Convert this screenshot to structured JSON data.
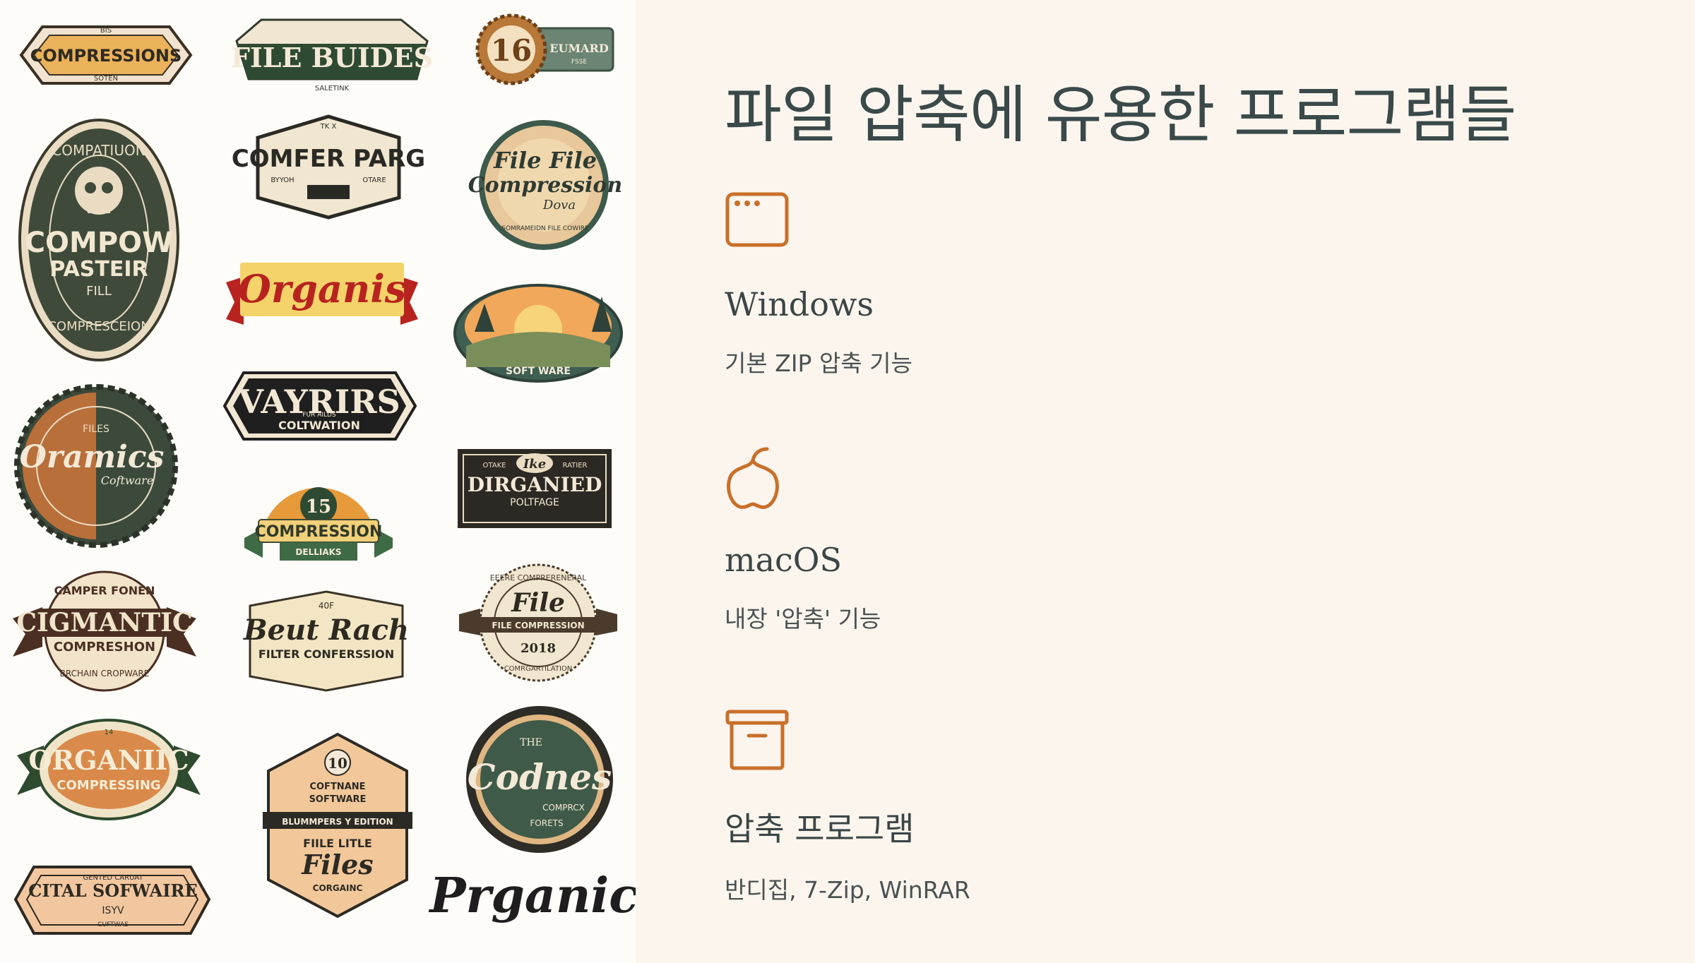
{
  "title": "파일 압축에 유용한 프로그램들",
  "accent_color": "#c8702a",
  "features": [
    {
      "icon": "window-icon",
      "heading": "Windows",
      "description": "기본 ZIP 압축 기능"
    },
    {
      "icon": "apple-icon",
      "heading": "macOS",
      "description": "내장 '압축' 기능"
    },
    {
      "icon": "archive-box-icon",
      "heading": "압축 프로그램",
      "description": "반디집, 7-Zip, WinRAR"
    }
  ],
  "badges": {
    "b1": {
      "top": "BIS",
      "main": "COMPRESSIONS",
      "bottom": "SOTEN"
    },
    "b2": {
      "main": "FILE BUIDES",
      "bottom": "SALETINK"
    },
    "b3": {
      "number": "16",
      "main": "EUMARD",
      "sub": "FSSE"
    },
    "b4": {
      "top": "COMPATIUON",
      "main": "COMPOW",
      "main2": "PASTEIR",
      "sub": "FILL",
      "bottom": "COMPRESCEION"
    },
    "b5": {
      "top": "TK X",
      "main": "COMFER PARG",
      "sub_left": "BYYOH",
      "sub_right": "OTARE"
    },
    "b6": {
      "main": "File File",
      "main2": "Compression",
      "sub": "Dova",
      "bottom": "SOMRAMEIDN FILE COWIRE"
    },
    "b7": {
      "main": "Organis"
    },
    "b8": {
      "bottom": "SOFT WARE"
    },
    "b9": {
      "main": "VAYRIRS",
      "sub": "FUR AILDS",
      "bottom": "COLTWATION"
    },
    "b10": {
      "top": "FILES",
      "main": "Oramics",
      "sub": "Coftware"
    },
    "b11": {
      "top": "OTAKE",
      "accent": "Ike",
      "top_right": "RATIER",
      "main": "DIRGANIED",
      "sub": "POLTFAGE"
    },
    "b12": {
      "number": "15",
      "main": "COMPRESSION",
      "bottom": "DELLIAKS"
    },
    "b13": {
      "top": "CAMPER FONEN",
      "main": "CIGMANTIC",
      "sub": "COMPRESHON",
      "bottom": "BRCHAIN CROPWARE"
    },
    "b14": {
      "top": "40F",
      "main": "Beut Rach",
      "sub": "FILTER CONFERSSION"
    },
    "b15": {
      "top": "EEERE COMPRERENERAL",
      "main": "File",
      "band": "FILE COMPRESSION",
      "year": "2018",
      "bottom": "COMRGARTILATION"
    },
    "b16": {
      "top": "14",
      "main": "ORGANIIC",
      "sub": "COMPRESSING"
    },
    "b17": {
      "number": "10",
      "line1": "COFTNANE",
      "line2": "SOFTWARE",
      "band": "BLUMMPERS Y EDITION",
      "line3": "FIILE LITLE",
      "main": "Files",
      "bottom": "CORGAINC"
    },
    "b18": {
      "top": "THE",
      "main": "Codnes",
      "sub": "COMPRCX",
      "bottom": "FORETS"
    },
    "b19": {
      "top": "GENTED CARUAT",
      "main": "CITAL SOFWAIRE",
      "sub": "ISYV",
      "bottom": "CUFTWAS"
    },
    "b20": {
      "main": "Prganic"
    }
  }
}
